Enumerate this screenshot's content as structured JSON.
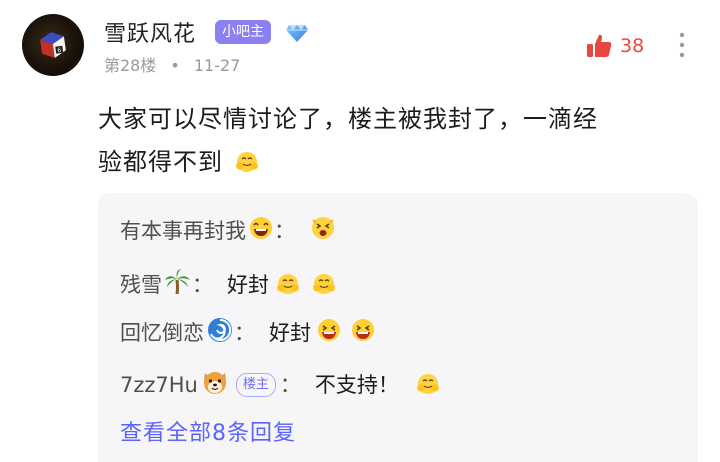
{
  "post": {
    "username": "雪跃风花",
    "role_badge": "小吧主",
    "floor": "第28楼",
    "separator": "•",
    "date": "11-27",
    "likes": "38",
    "content_text_1": "大家可以尽情讨论了，楼主被我封了，一滴经",
    "content_text_2": "验都得不到",
    "colors": {
      "badge": "#8b80f0",
      "like": "#e8473f",
      "link": "#5a63ff",
      "louzhu": "#6f6ff0"
    }
  },
  "replies": {
    "items": [
      {
        "name": "有本事再封我",
        "sep": "：",
        "text": "",
        "icons": [
          "laughing-emoji",
          "cheering-emoji"
        ]
      },
      {
        "name": "残雪",
        "sep": "：",
        "text": "好封",
        "icons": [
          "palm-tree-emoji",
          "cheering-emoji",
          "cheering-emoji"
        ]
      },
      {
        "name": "回忆倒恋",
        "sep": "：",
        "text": "好封",
        "icons": [
          "swirl-emoji",
          "grinning-emoji",
          "grinning-emoji"
        ]
      },
      {
        "name": "7zz7Hu",
        "badge": "楼主",
        "sep": "：",
        "text": "不支持！",
        "icons": [
          "shiba-dog-emoji",
          "cheering-emoji"
        ]
      }
    ],
    "view_all": "查看全部8条回复"
  },
  "icons": {
    "avatar": "cube-avatar",
    "diamond": "diamond-icon",
    "like": "thumbs-up-icon",
    "more": "more-vertical-icon"
  }
}
